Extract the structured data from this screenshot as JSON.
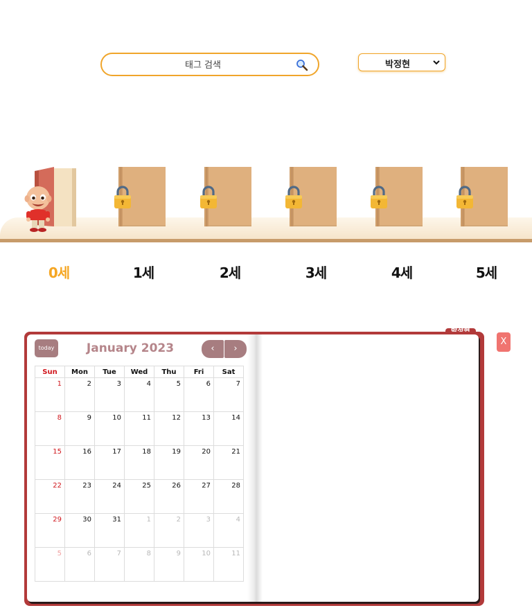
{
  "search": {
    "placeholder": "태그 검색",
    "icon": "search-icon"
  },
  "user_select": {
    "selected": "박정현"
  },
  "ages": [
    {
      "label": "0세",
      "color": "#f5a623",
      "unlocked": true
    },
    {
      "label": "1세",
      "color": "#111111",
      "unlocked": false
    },
    {
      "label": "2세",
      "color": "#111111",
      "unlocked": false
    },
    {
      "label": "3세",
      "color": "#111111",
      "unlocked": false
    },
    {
      "label": "4세",
      "color": "#111111",
      "unlocked": false
    },
    {
      "label": "5세",
      "color": "#111111",
      "unlocked": false
    }
  ],
  "diary": {
    "owner_tag": "박정현",
    "close_label": "X",
    "calendar": {
      "today_label": "today",
      "title": "January 2023",
      "prev_label": "‹",
      "next_label": "›",
      "weekdays": [
        "Sun",
        "Mon",
        "Tue",
        "Wed",
        "Thu",
        "Fri",
        "Sat"
      ],
      "weeks": [
        [
          "1",
          "2",
          "3",
          "4",
          "5",
          "6",
          "7"
        ],
        [
          "8",
          "9",
          "10",
          "11",
          "12",
          "13",
          "14"
        ],
        [
          "15",
          "16",
          "17",
          "18",
          "19",
          "20",
          "21"
        ],
        [
          "22",
          "23",
          "24",
          "25",
          "26",
          "27",
          "28"
        ],
        [
          "29",
          "30",
          "31",
          "1",
          "2",
          "3",
          "4"
        ],
        [
          "5",
          "6",
          "7",
          "8",
          "9",
          "10",
          "11"
        ]
      ]
    }
  },
  "colors": {
    "accent": "#f0a52a",
    "frame": "#b23a3a",
    "calendar_button": "#a77d80",
    "sunday": "#d0161c"
  }
}
